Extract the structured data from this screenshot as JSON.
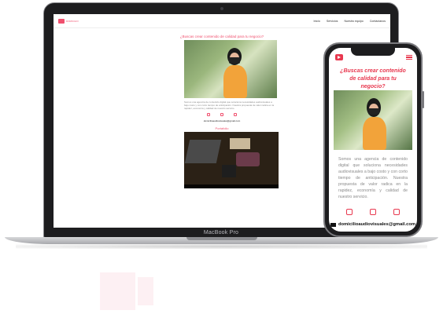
{
  "laptop": {
    "model_label": "MacBook Pro",
    "site": {
      "logo_text": "DOMICILIO",
      "nav": [
        "Inicio",
        "Servicios",
        "Nuestro equipo",
        "Contáctanos"
      ],
      "heading": "¿Buscas crear contenido de calidad para tu negocio?",
      "hero_text": "Somos una agencia de contenido digital que soluciona necesidades audiovisuales a bajo costo y con corto tiempo de anticipación. Nuestra propuesta de valor radica en la rapidez, economía y calidad de nuestro servicio.",
      "email": "domicilioaudiovisuales@gmail.com",
      "portfolio_title": "Portafolio"
    }
  },
  "phone": {
    "heading": "¿Buscas crear contenido de calidad para tu negocio?",
    "body": "Somos una agencia de contenido digital que soluciona necesidades audiovisuales a bajo costo y con corto tiempo de anticipación. Nuestra propuesta de valor radica en la rapidez, economía y calidad de nuestro servicio.",
    "email": "domicilioaudiovisuales@gmail.com",
    "social_icons": [
      "instagram-icon",
      "youtube-icon",
      "camera-icon"
    ]
  },
  "colors": {
    "accent": "#e8384f",
    "device_body": "#1d1d1f",
    "body_text": "#8a8a8a"
  }
}
